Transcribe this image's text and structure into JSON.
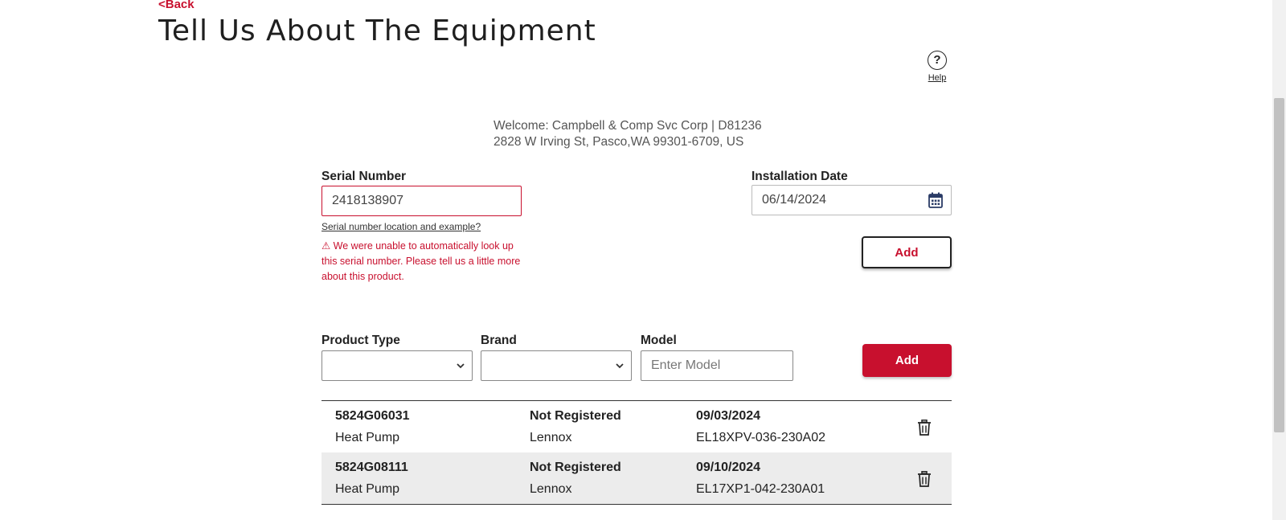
{
  "nav": {
    "back_label": "<Back"
  },
  "page": {
    "title": "Tell Us About The Equipment"
  },
  "help": {
    "label": "Help",
    "glyph": "?"
  },
  "welcome": {
    "line1": "Welcome: Campbell & Comp Svc Corp | D81236",
    "line2": "2828 W Irving St, Pasco,WA 99301-6709, US"
  },
  "serial": {
    "label": "Serial Number",
    "value": "2418138907",
    "help_link": "Serial number location and example?",
    "error": "⚠ We were unable to automatically look up this serial number. Please tell us a little more about this product."
  },
  "install_date": {
    "label": "Installation Date",
    "value": "06/14/2024"
  },
  "add_serial_button": {
    "label": "Add"
  },
  "product_type": {
    "label": "Product Type",
    "selected": ""
  },
  "brand": {
    "label": "Brand",
    "selected": ""
  },
  "model": {
    "label": "Model",
    "placeholder": "Enter Model",
    "value": ""
  },
  "add_product_button": {
    "label": "Add"
  },
  "equipment": [
    {
      "serial": "5824G06031",
      "type": "Heat Pump",
      "status": "Not Registered",
      "brand": "Lennox",
      "date": "09/03/2024",
      "model": "EL18XPV-036-230A02"
    },
    {
      "serial": "5824G08111",
      "type": "Heat Pump",
      "status": "Not Registered",
      "brand": "Lennox",
      "date": "09/10/2024",
      "model": "EL17XP1-042-230A01"
    }
  ],
  "icons": {
    "calendar": "calendar-icon",
    "trash": "trash-icon",
    "chevron": "chevron-down-icon",
    "help": "help-circle-icon",
    "warning": "warning-icon"
  },
  "colors": {
    "accent": "#c8102e",
    "row_alt": "#ececec"
  }
}
